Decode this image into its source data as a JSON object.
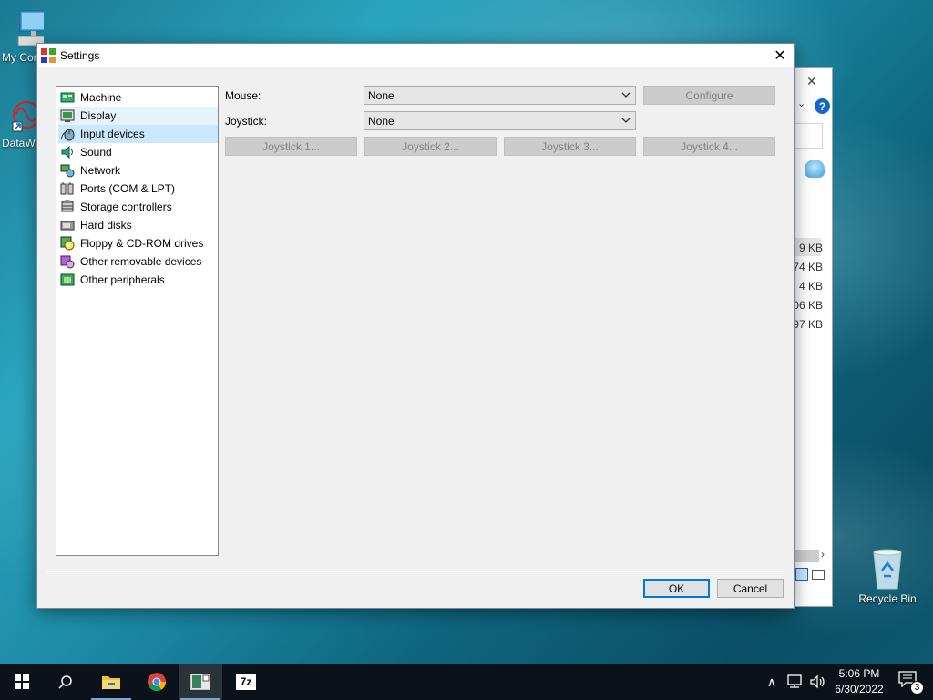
{
  "desktop": {
    "icons": [
      {
        "label": "My Cor",
        "icon": "computer-icon"
      },
      {
        "label": "DataWa",
        "icon": "datawave-shortcut-icon"
      },
      {
        "label": "Recycle Bin",
        "icon": "recycle-bin-icon"
      }
    ]
  },
  "background_window": {
    "sizes": [
      "9 KB",
      "74 KB",
      "4 KB",
      "06 KB",
      "97 KB"
    ]
  },
  "dialog": {
    "title": "Settings",
    "close_glyph": "✕",
    "tree_items": [
      {
        "label": "Machine",
        "icon": "machine-icon"
      },
      {
        "label": "Display",
        "icon": "display-icon"
      },
      {
        "label": "Input devices",
        "icon": "input-devices-icon"
      },
      {
        "label": "Sound",
        "icon": "sound-icon"
      },
      {
        "label": "Network",
        "icon": "network-icon"
      },
      {
        "label": "Ports (COM & LPT)",
        "icon": "ports-icon"
      },
      {
        "label": "Storage controllers",
        "icon": "storage-controllers-icon"
      },
      {
        "label": "Hard disks",
        "icon": "hard-disks-icon"
      },
      {
        "label": "Floppy & CD-ROM drives",
        "icon": "floppy-cdrom-icon"
      },
      {
        "label": "Other removable devices",
        "icon": "removable-devices-icon"
      },
      {
        "label": "Other peripherals",
        "icon": "peripherals-icon"
      }
    ],
    "selected_item": "Input devices",
    "mouse": {
      "label": "Mouse:",
      "value": "None",
      "configure_label": "Configure"
    },
    "joystick": {
      "label": "Joystick:",
      "value": "None"
    },
    "joystick_buttons": [
      "Joystick 1...",
      "Joystick 2...",
      "Joystick 3...",
      "Joystick 4..."
    ],
    "ok_label": "OK",
    "cancel_label": "Cancel"
  },
  "taskbar": {
    "apps": [
      "start-icon",
      "search-icon",
      "file-explorer-icon",
      "chrome-icon",
      "emulator-icon",
      "7zip-icon"
    ],
    "sevenzip_label": "7z",
    "tray_chevron": "∧",
    "clock_time": "5:06 PM",
    "clock_date": "6/30/2022",
    "notification_count": "3"
  },
  "colors": {
    "accent": "#0078d7",
    "selection": "#cce8ff",
    "hover": "#e5f3fb",
    "disabled_text": "#838383"
  }
}
